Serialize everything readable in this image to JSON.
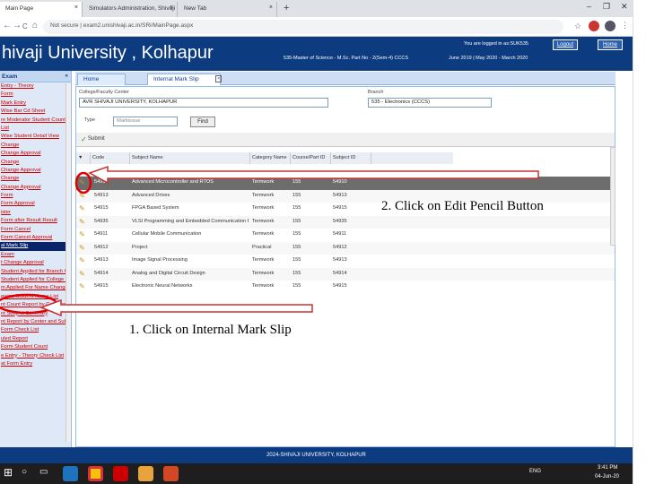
{
  "browser": {
    "tabs": [
      {
        "label": "Main Page",
        "close": "×"
      },
      {
        "label": "Simulators Administration, Shivaji",
        "close": "×"
      },
      {
        "label": "New Tab",
        "close": "×"
      }
    ],
    "new_tab": "+",
    "url": "Not secure | exam2.unishivaji.ac.in/SRi/MainPage.aspx",
    "nav": {
      "back": "←",
      "forward": "→",
      "reload": "C",
      "home": "⌂"
    }
  },
  "header": {
    "title": "hivaji University , Kolhapur",
    "logged_in": "You are logged in as:SUK535",
    "course": "535-Master of Science - M.Sc. Part No - 2(Sem-4) CCCS",
    "session": "June 2019 | May 2020 - March 2020",
    "logout_label": "Logout",
    "home_label": "Home"
  },
  "sidebar": {
    "heading": "Exam",
    "items": [
      "Entry - Theory",
      "Form",
      "Mark Entry",
      "Wise Bar Cd Sheet",
      "re Moderator Student Count",
      "List",
      "Wise Student Detail View",
      "Change",
      "Change Approval",
      "Change",
      "Change Approval",
      "Change",
      "Change Approval",
      "Form",
      "Form Approval",
      "ister",
      "Form after Result Result",
      "Form Cancel",
      "Form Cancel Approval",
      "al Mark Slip",
      "Exam",
      "t Change Approval",
      "Student Applied for Branch C",
      "Student Applied for College C",
      "m Applied For Name Change",
      "ewise Student Name List",
      "nt Count Report by Colledcode",
      "nt Subject Summary",
      "nt Report by Center and Subjec",
      "Form Check List",
      "uled Report",
      "Form Student Count",
      "e Entry - Theory Check List",
      "at Form Entry"
    ],
    "selected_index": 19
  },
  "panel_tabs": [
    {
      "label": "Home"
    },
    {
      "label": "Internal Mark Slip"
    }
  ],
  "filters": {
    "college_label": "College/Faculty Center",
    "college_value": "AVR SHIVAJI UNIVERSITY, KOLHAPUR",
    "branch_label": "Branch",
    "branch_value": "535 - Electronics (CCCS)",
    "type_label": "Type",
    "type_value": "Markissue",
    "find_label": "Find"
  },
  "toolbar": {
    "submit_label": "Submit"
  },
  "grid": {
    "columns": [
      "Code",
      "Subject Name",
      "Category Name",
      "Course/Part ID",
      "Subject ID"
    ],
    "rows": [
      {
        "code": "54910",
        "name": "Advanced Microcontroller and RTOS",
        "cat": "Termwork",
        "course": "155",
        "sid": "54910",
        "selected": true
      },
      {
        "code": "54913",
        "name": "Advanced Drives",
        "cat": "Termwork",
        "course": "155",
        "sid": "54913"
      },
      {
        "code": "54915",
        "name": "FPGA Based System",
        "cat": "Termwork",
        "course": "155",
        "sid": "54915"
      },
      {
        "code": "54935",
        "name": "VLSI Programming and Embedded Communication Protocols",
        "cat": "Termwork",
        "course": "155",
        "sid": "54935"
      },
      {
        "code": "54911",
        "name": "Cellular Mobile Communication",
        "cat": "Termwork",
        "course": "155",
        "sid": "54911"
      },
      {
        "code": "54912",
        "name": "Project",
        "cat": "Practical",
        "course": "155",
        "sid": "54912"
      },
      {
        "code": "54913",
        "name": "Image Signal Processing",
        "cat": "Termwork",
        "course": "155",
        "sid": "54913"
      },
      {
        "code": "54914",
        "name": "Analog and Digital Circuit Design",
        "cat": "Termwork",
        "course": "155",
        "sid": "54914"
      },
      {
        "code": "54915",
        "name": "Electronic Neural Networks",
        "cat": "Termwork",
        "course": "155",
        "sid": "54915"
      }
    ]
  },
  "annotations": {
    "step1": "1.    Click on Internal Mark Slip",
    "step2": "2.  Click on Edit Pencil Button"
  },
  "footer": {
    "text": "2024-SHIVAJI UNIVERSITY, KOLHAPUR"
  },
  "taskbar": {
    "time": "3:41 PM",
    "date": "04-Jun-20",
    "lang": "ENG"
  },
  "colors": {
    "header": "#0c3b80",
    "annotation_red": "#e00000",
    "selected_row": "#6d6d6d"
  }
}
